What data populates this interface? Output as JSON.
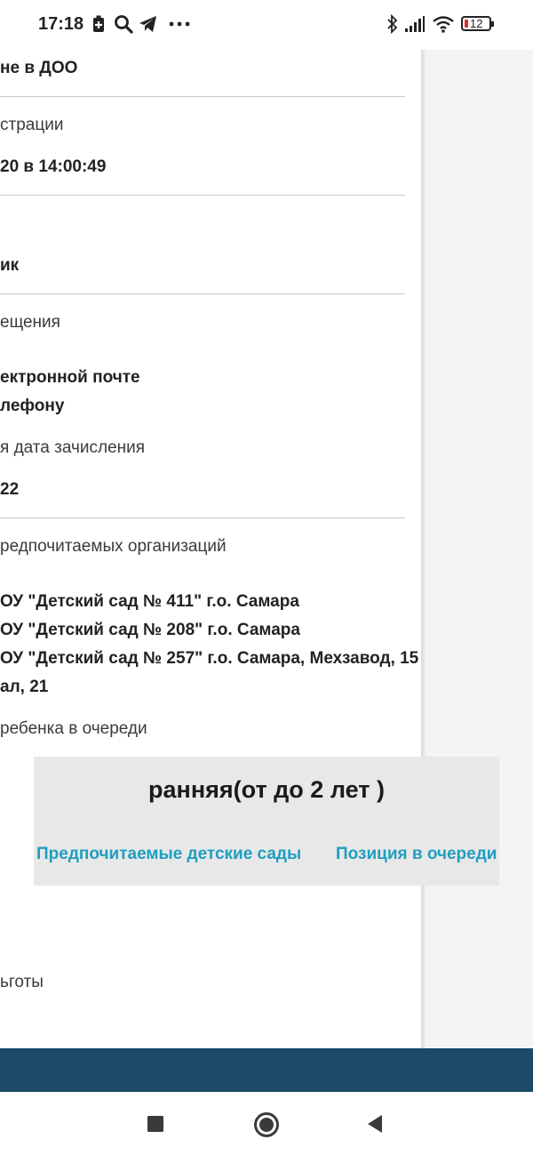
{
  "status_bar": {
    "time": "17:18",
    "battery_level": "12",
    "icons": [
      "battery-saver-icon",
      "search-icon",
      "telegram-icon",
      "more-icon",
      "bluetooth-icon",
      "signal-icon",
      "wifi-icon",
      "battery-icon"
    ]
  },
  "details": {
    "directed_label": "не в ДОО",
    "registration_label": "страции",
    "registration_value": "20 в 14:00:49",
    "row3_value": "ик",
    "notify_label": "ещения",
    "notify_email": "ектронной почте",
    "notify_phone": "лефону",
    "enroll_date_label": "я дата зачисления",
    "enroll_date_value": "22",
    "orgs_label": "редпочитаемых организаций",
    "orgs": [
      "ОУ \"Детский сад № 411\" г.о. Самара",
      "ОУ \"Детский сад № 208\" г.о. Самара",
      "ОУ \"Детский сад № 257\" г.о. Самара, Мехзавод, 15",
      "ал, 21"
    ],
    "queue_label": "ребенка в очереди",
    "benefits_label": "ьготы"
  },
  "queue_card": {
    "title": "ранняя(от до 2 лет )",
    "link_preferred": "Предпочитаемые детские сады",
    "link_position": "Позиция в очереди"
  },
  "colors": {
    "link": "#1f9ec0",
    "footer": "#1c4a68",
    "card_bg": "#e8e8e8"
  }
}
